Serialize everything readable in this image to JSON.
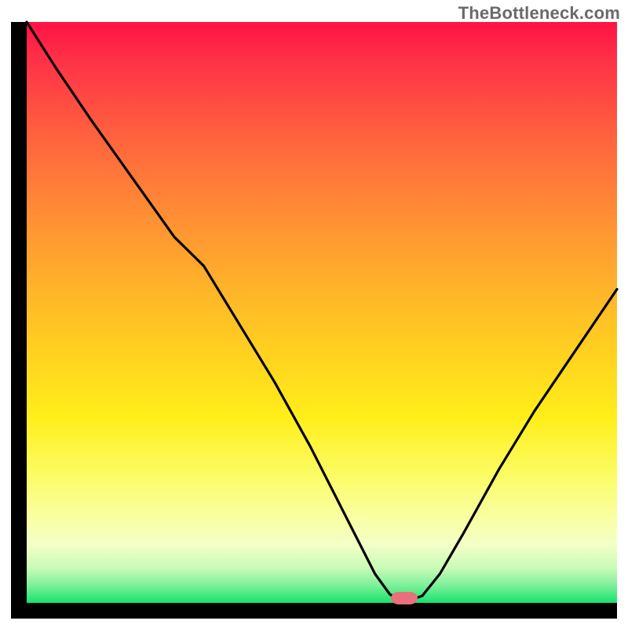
{
  "watermark": "TheBottleneck.com",
  "chart_data": {
    "type": "line",
    "title": "",
    "xlabel": "",
    "ylabel": "",
    "xlim": [
      0,
      100
    ],
    "ylim": [
      0,
      100
    ],
    "grid": false,
    "legend": false,
    "series": [
      {
        "name": "bottleneck-curve",
        "x": [
          0,
          5,
          11,
          18,
          25,
          30,
          36,
          42,
          48,
          52,
          56,
          59,
          61.5,
          63,
          65,
          67,
          70,
          74,
          80,
          86,
          92,
          100
        ],
        "y": [
          100,
          92,
          83,
          73,
          63,
          58,
          48,
          38,
          27,
          19,
          11,
          5,
          1.5,
          0.5,
          0.5,
          1.2,
          5,
          12,
          23,
          33,
          42,
          54
        ]
      }
    ],
    "marker": {
      "x_center": 64,
      "y": 0.5,
      "color": "#e96f7a"
    },
    "background_gradient_stops": [
      {
        "pos": 0.0,
        "color": "#ff1244"
      },
      {
        "pos": 0.06,
        "color": "#ff2f47"
      },
      {
        "pos": 0.18,
        "color": "#ff5c3f"
      },
      {
        "pos": 0.32,
        "color": "#ff8a36"
      },
      {
        "pos": 0.46,
        "color": "#ffb429"
      },
      {
        "pos": 0.58,
        "color": "#ffd41f"
      },
      {
        "pos": 0.68,
        "color": "#ffee1a"
      },
      {
        "pos": 0.78,
        "color": "#fcfc64"
      },
      {
        "pos": 0.85,
        "color": "#f9ffa0"
      },
      {
        "pos": 0.9,
        "color": "#f3ffc7"
      },
      {
        "pos": 0.94,
        "color": "#c9fbb7"
      },
      {
        "pos": 0.97,
        "color": "#7df09a"
      },
      {
        "pos": 1.0,
        "color": "#17e36d"
      }
    ]
  }
}
